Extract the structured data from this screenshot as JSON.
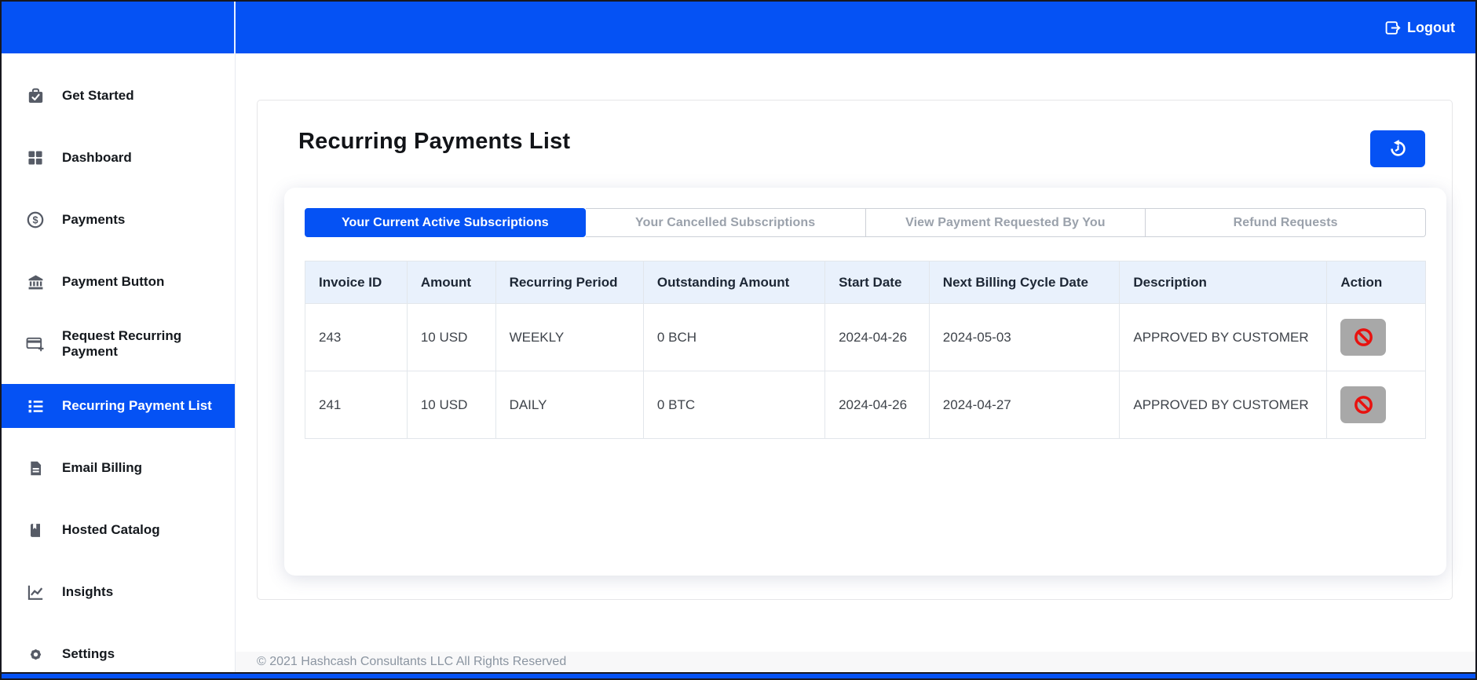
{
  "topbar": {
    "logout_label": "Logout"
  },
  "sidebar": {
    "items": [
      {
        "label": "Get Started",
        "icon": "briefcase-check-icon",
        "active": false
      },
      {
        "label": "Dashboard",
        "icon": "dashboard-grid-icon",
        "active": false
      },
      {
        "label": "Payments",
        "icon": "dollar-circle-icon",
        "active": false
      },
      {
        "label": "Payment Button",
        "icon": "bank-icon",
        "active": false
      },
      {
        "label": "Request Recurring Payment",
        "icon": "card-plus-icon",
        "active": false
      },
      {
        "label": "Recurring Payment List",
        "icon": "list-icon",
        "active": true
      },
      {
        "label": "Email Billing",
        "icon": "file-icon",
        "active": false
      },
      {
        "label": "Hosted Catalog",
        "icon": "book-icon",
        "active": false
      },
      {
        "label": "Insights",
        "icon": "chart-line-icon",
        "active": false
      },
      {
        "label": "Settings",
        "icon": "gear-icon",
        "active": false
      }
    ]
  },
  "main": {
    "title": "Recurring Payments List",
    "tabs": [
      {
        "label": "Your Current Active Subscriptions",
        "active": true
      },
      {
        "label": "Your Cancelled Subscriptions",
        "active": false
      },
      {
        "label": "View Payment Requested By You",
        "active": false
      },
      {
        "label": "Refund Requests",
        "active": false
      }
    ],
    "table": {
      "columns": [
        "Invoice ID",
        "Amount",
        "Recurring Period",
        "Outstanding Amount",
        "Start Date",
        "Next Billing Cycle Date",
        "Description",
        "Action"
      ],
      "rows": [
        {
          "invoice_id": "243",
          "amount": "10 USD",
          "recurring_period": "WEEKLY",
          "outstanding_amount": "0 BCH",
          "start_date": "2024-04-26",
          "next_billing_cycle_date": "2024-05-03",
          "description": "APPROVED BY CUSTOMER"
        },
        {
          "invoice_id": "241",
          "amount": "10 USD",
          "recurring_period": "DAILY",
          "outstanding_amount": "0 BTC",
          "start_date": "2024-04-26",
          "next_billing_cycle_date": "2024-04-27",
          "description": "APPROVED BY CUSTOMER"
        }
      ]
    }
  },
  "footer": {
    "copyright": "© 2021 Hashcash Consultants LLC All Rights Reserved"
  },
  "colors": {
    "accent_blue": "#0552f4",
    "ban_red": "#e8120f",
    "action_gray": "#a8a8a8",
    "table_header_bg": "#e9f1fc",
    "footer_bg": "#f8f8f9"
  }
}
